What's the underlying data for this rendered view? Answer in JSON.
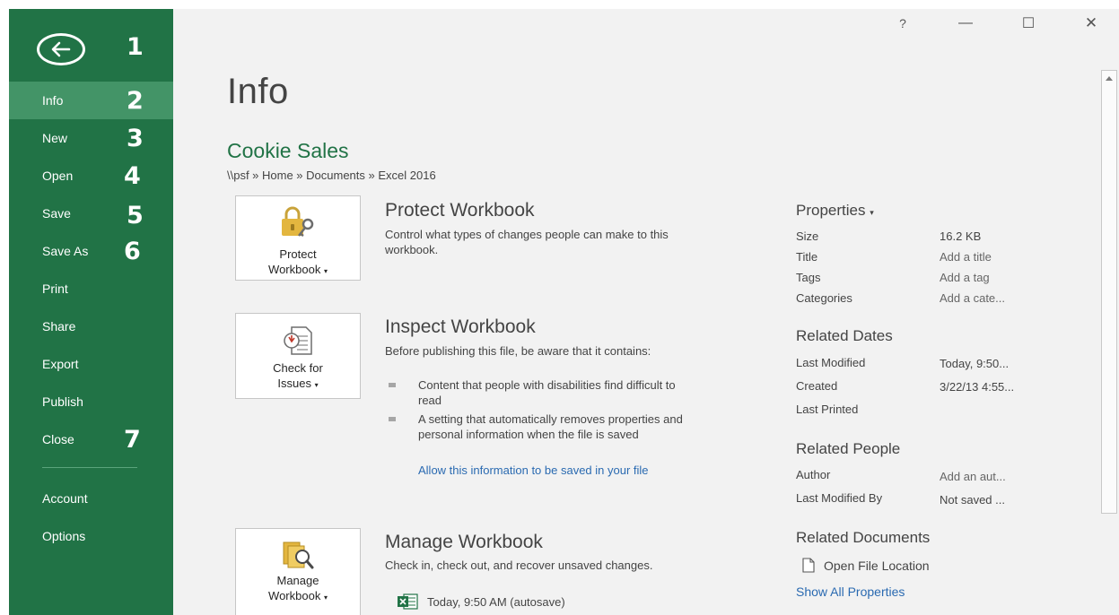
{
  "sidebar": {
    "items": [
      {
        "label": "Info"
      },
      {
        "label": "New"
      },
      {
        "label": "Open"
      },
      {
        "label": "Save"
      },
      {
        "label": "Save As"
      },
      {
        "label": "Print"
      },
      {
        "label": "Share"
      },
      {
        "label": "Export"
      },
      {
        "label": "Publish"
      },
      {
        "label": "Close"
      },
      {
        "label": "Account"
      },
      {
        "label": "Options"
      }
    ],
    "callouts": [
      "1",
      "2",
      "3",
      "4",
      "5",
      "6",
      "7"
    ]
  },
  "window": {
    "help": "?",
    "minimize": "—",
    "maximize": "☐",
    "close": "✕"
  },
  "main": {
    "title": "Info",
    "doc_title": "Cookie Sales",
    "path": "\\\\psf » Home » Documents » Excel 2016"
  },
  "protect": {
    "tile_line1": "Protect",
    "tile_line2": "Workbook",
    "heading": "Protect Workbook",
    "desc": "Control what types of changes people can make to this workbook."
  },
  "inspect": {
    "tile_line1": "Check for",
    "tile_line2": "Issues",
    "heading": "Inspect Workbook",
    "desc": "Before publishing this file, be aware that it contains:",
    "bullets": [
      "Content that people with disabilities find difficult to read",
      "A setting that automatically removes properties and personal information when the file is saved"
    ],
    "link": "Allow this information to be saved in your file"
  },
  "manage": {
    "tile_line1": "Manage",
    "tile_line2": "Workbook",
    "heading": "Manage Workbook",
    "desc": "Check in, check out, and recover unsaved changes.",
    "version": "Today, 9:50 AM (autosave)"
  },
  "properties": {
    "heading": "Properties",
    "rows": [
      {
        "label": "Size",
        "value": "16.2 KB"
      },
      {
        "label": "Title",
        "value": "Add a title"
      },
      {
        "label": "Tags",
        "value": "Add a tag"
      },
      {
        "label": "Categories",
        "value": "Add a cate..."
      }
    ],
    "dates_heading": "Related Dates",
    "dates": [
      {
        "label": "Last Modified",
        "value": "Today, 9:50..."
      },
      {
        "label": "Created",
        "value": "3/22/13 4:55..."
      },
      {
        "label": "Last Printed",
        "value": ""
      }
    ],
    "people_heading": "Related People",
    "people": [
      {
        "label": "Author",
        "value": "Add an aut..."
      },
      {
        "label": "Last Modified By",
        "value": "Not saved ..."
      }
    ],
    "docs_heading": "Related Documents",
    "open_file_location": "Open File Location",
    "show_all": "Show All Properties"
  },
  "colors": {
    "accent": "#217346",
    "accent_active": "#439467",
    "link": "#2a6ab1"
  }
}
